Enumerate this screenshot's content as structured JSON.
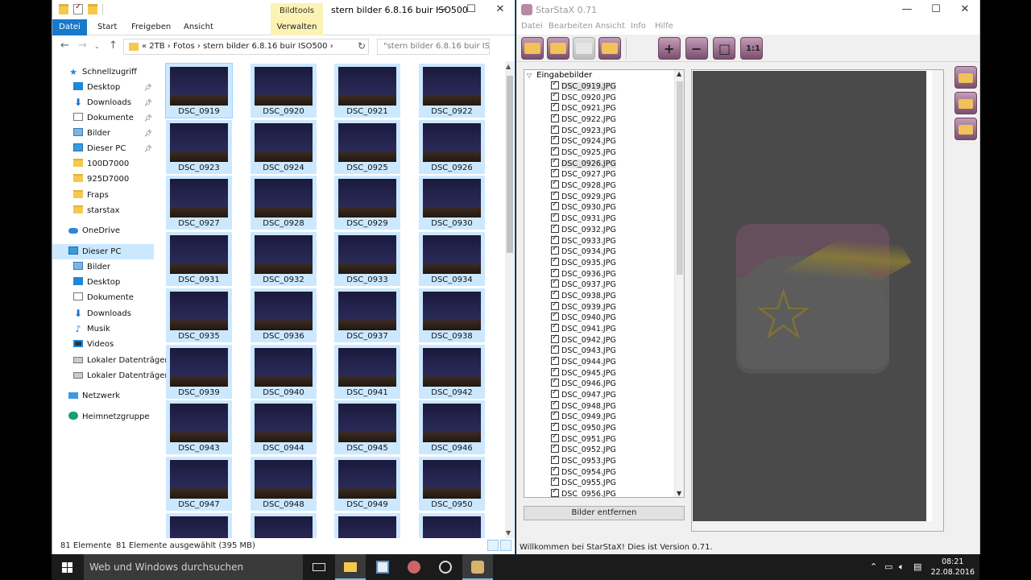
{
  "explorer": {
    "title": "stern bilder 6.8.16 buir ISO500",
    "contextual_tab": "Bildtools",
    "ribbon_tabs": [
      "Datei",
      "Start",
      "Freigeben",
      "Ansicht",
      "Verwalten"
    ],
    "breadcrumb": "«   2TB  ›  Fotos  ›  stern bilder 6.8.16 buir ISO500  ›",
    "search_placeholder": "\"stern bilder 6.8.16 buir ISO50...",
    "nav": [
      {
        "label": "Schnellzugriff",
        "icon": "star-icon"
      },
      {
        "label": "Desktop",
        "icon": "desktop-icon"
      },
      {
        "label": "Downloads",
        "icon": "download-icon"
      },
      {
        "label": "Dokumente",
        "icon": "document-icon"
      },
      {
        "label": "Bilder",
        "icon": "pictures-icon"
      },
      {
        "label": "Dieser PC",
        "icon": "pc-icon"
      },
      {
        "label": "100D7000",
        "icon": "folder-icon"
      },
      {
        "label": "925D7000",
        "icon": "folder-icon"
      },
      {
        "label": "Fraps",
        "icon": "folder-icon"
      },
      {
        "label": "starstax",
        "icon": "folder-icon"
      },
      {
        "label": "OneDrive",
        "icon": "cloud-icon"
      },
      {
        "label": "Dieser PC",
        "icon": "pc-icon"
      },
      {
        "label": "Bilder",
        "icon": "pictures-icon"
      },
      {
        "label": "Desktop",
        "icon": "desktop-icon"
      },
      {
        "label": "Dokumente",
        "icon": "document-icon"
      },
      {
        "label": "Downloads",
        "icon": "download-icon"
      },
      {
        "label": "Musik",
        "icon": "music-icon"
      },
      {
        "label": "Videos",
        "icon": "video-icon"
      },
      {
        "label": "Lokaler Datenträger",
        "icon": "drive-icon"
      },
      {
        "label": "Lokaler Datenträger",
        "icon": "drive-icon"
      },
      {
        "label": "Netzwerk",
        "icon": "network-icon"
      },
      {
        "label": "Heimnetzgruppe",
        "icon": "homegroup-icon"
      }
    ],
    "thumbnails": [
      "DSC_0919",
      "DSC_0920",
      "DSC_0921",
      "DSC_0922",
      "DSC_0923",
      "DSC_0924",
      "DSC_0925",
      "DSC_0926",
      "DSC_0927",
      "DSC_0928",
      "DSC_0929",
      "DSC_0930",
      "DSC_0931",
      "DSC_0932",
      "DSC_0933",
      "DSC_0934",
      "DSC_0935",
      "DSC_0936",
      "DSC_0937",
      "DSC_0938",
      "DSC_0939",
      "DSC_0940",
      "DSC_0941",
      "DSC_0942",
      "DSC_0943",
      "DSC_0944",
      "DSC_0945",
      "DSC_0946",
      "DSC_0947",
      "DSC_0948",
      "DSC_0949",
      "DSC_0950",
      "",
      "",
      "",
      ""
    ],
    "status_count": "81 Elemente",
    "status_selected": "81 Elemente ausgewählt (395 MB)"
  },
  "starstax": {
    "title": "StarStaX 0.71",
    "menu": [
      "Datei",
      "Bearbeiten",
      "Ansicht",
      "Info",
      "Hilfe"
    ],
    "tree_root": "Eingabebilder",
    "files": [
      "DSC_0919.JPG",
      "DSC_0920.JPG",
      "DSC_0921.JPG",
      "DSC_0922.JPG",
      "DSC_0923.JPG",
      "DSC_0924.JPG",
      "DSC_0925.JPG",
      "DSC_0926.JPG",
      "DSC_0927.JPG",
      "DSC_0928.JPG",
      "DSC_0929.JPG",
      "DSC_0930.JPG",
      "DSC_0931.JPG",
      "DSC_0932.JPG",
      "DSC_0933.JPG",
      "DSC_0934.JPG",
      "DSC_0935.JPG",
      "DSC_0936.JPG",
      "DSC_0937.JPG",
      "DSC_0938.JPG",
      "DSC_0939.JPG",
      "DSC_0940.JPG",
      "DSC_0941.JPG",
      "DSC_0942.JPG",
      "DSC_0943.JPG",
      "DSC_0944.JPG",
      "DSC_0945.JPG",
      "DSC_0946.JPG",
      "DSC_0947.JPG",
      "DSC_0948.JPG",
      "DSC_0949.JPG",
      "DSC_0950.JPG",
      "DSC_0951.JPG",
      "DSC_0952.JPG",
      "DSC_0953.JPG",
      "DSC_0954.JPG",
      "DSC_0955.JPG",
      "DSC_0956.JPG"
    ],
    "remove_button": "Bilder entfernen",
    "status": "Willkommen bei StarStaX! Dies ist Version 0.71."
  },
  "taskbar": {
    "search_placeholder": "Web und Windows durchsuchen",
    "time": "08:21",
    "date": "22.08.2016"
  },
  "colors": {
    "accent": "#1979ca",
    "selection": "#cce8ff",
    "starstax_button": "#7a4f6e"
  }
}
